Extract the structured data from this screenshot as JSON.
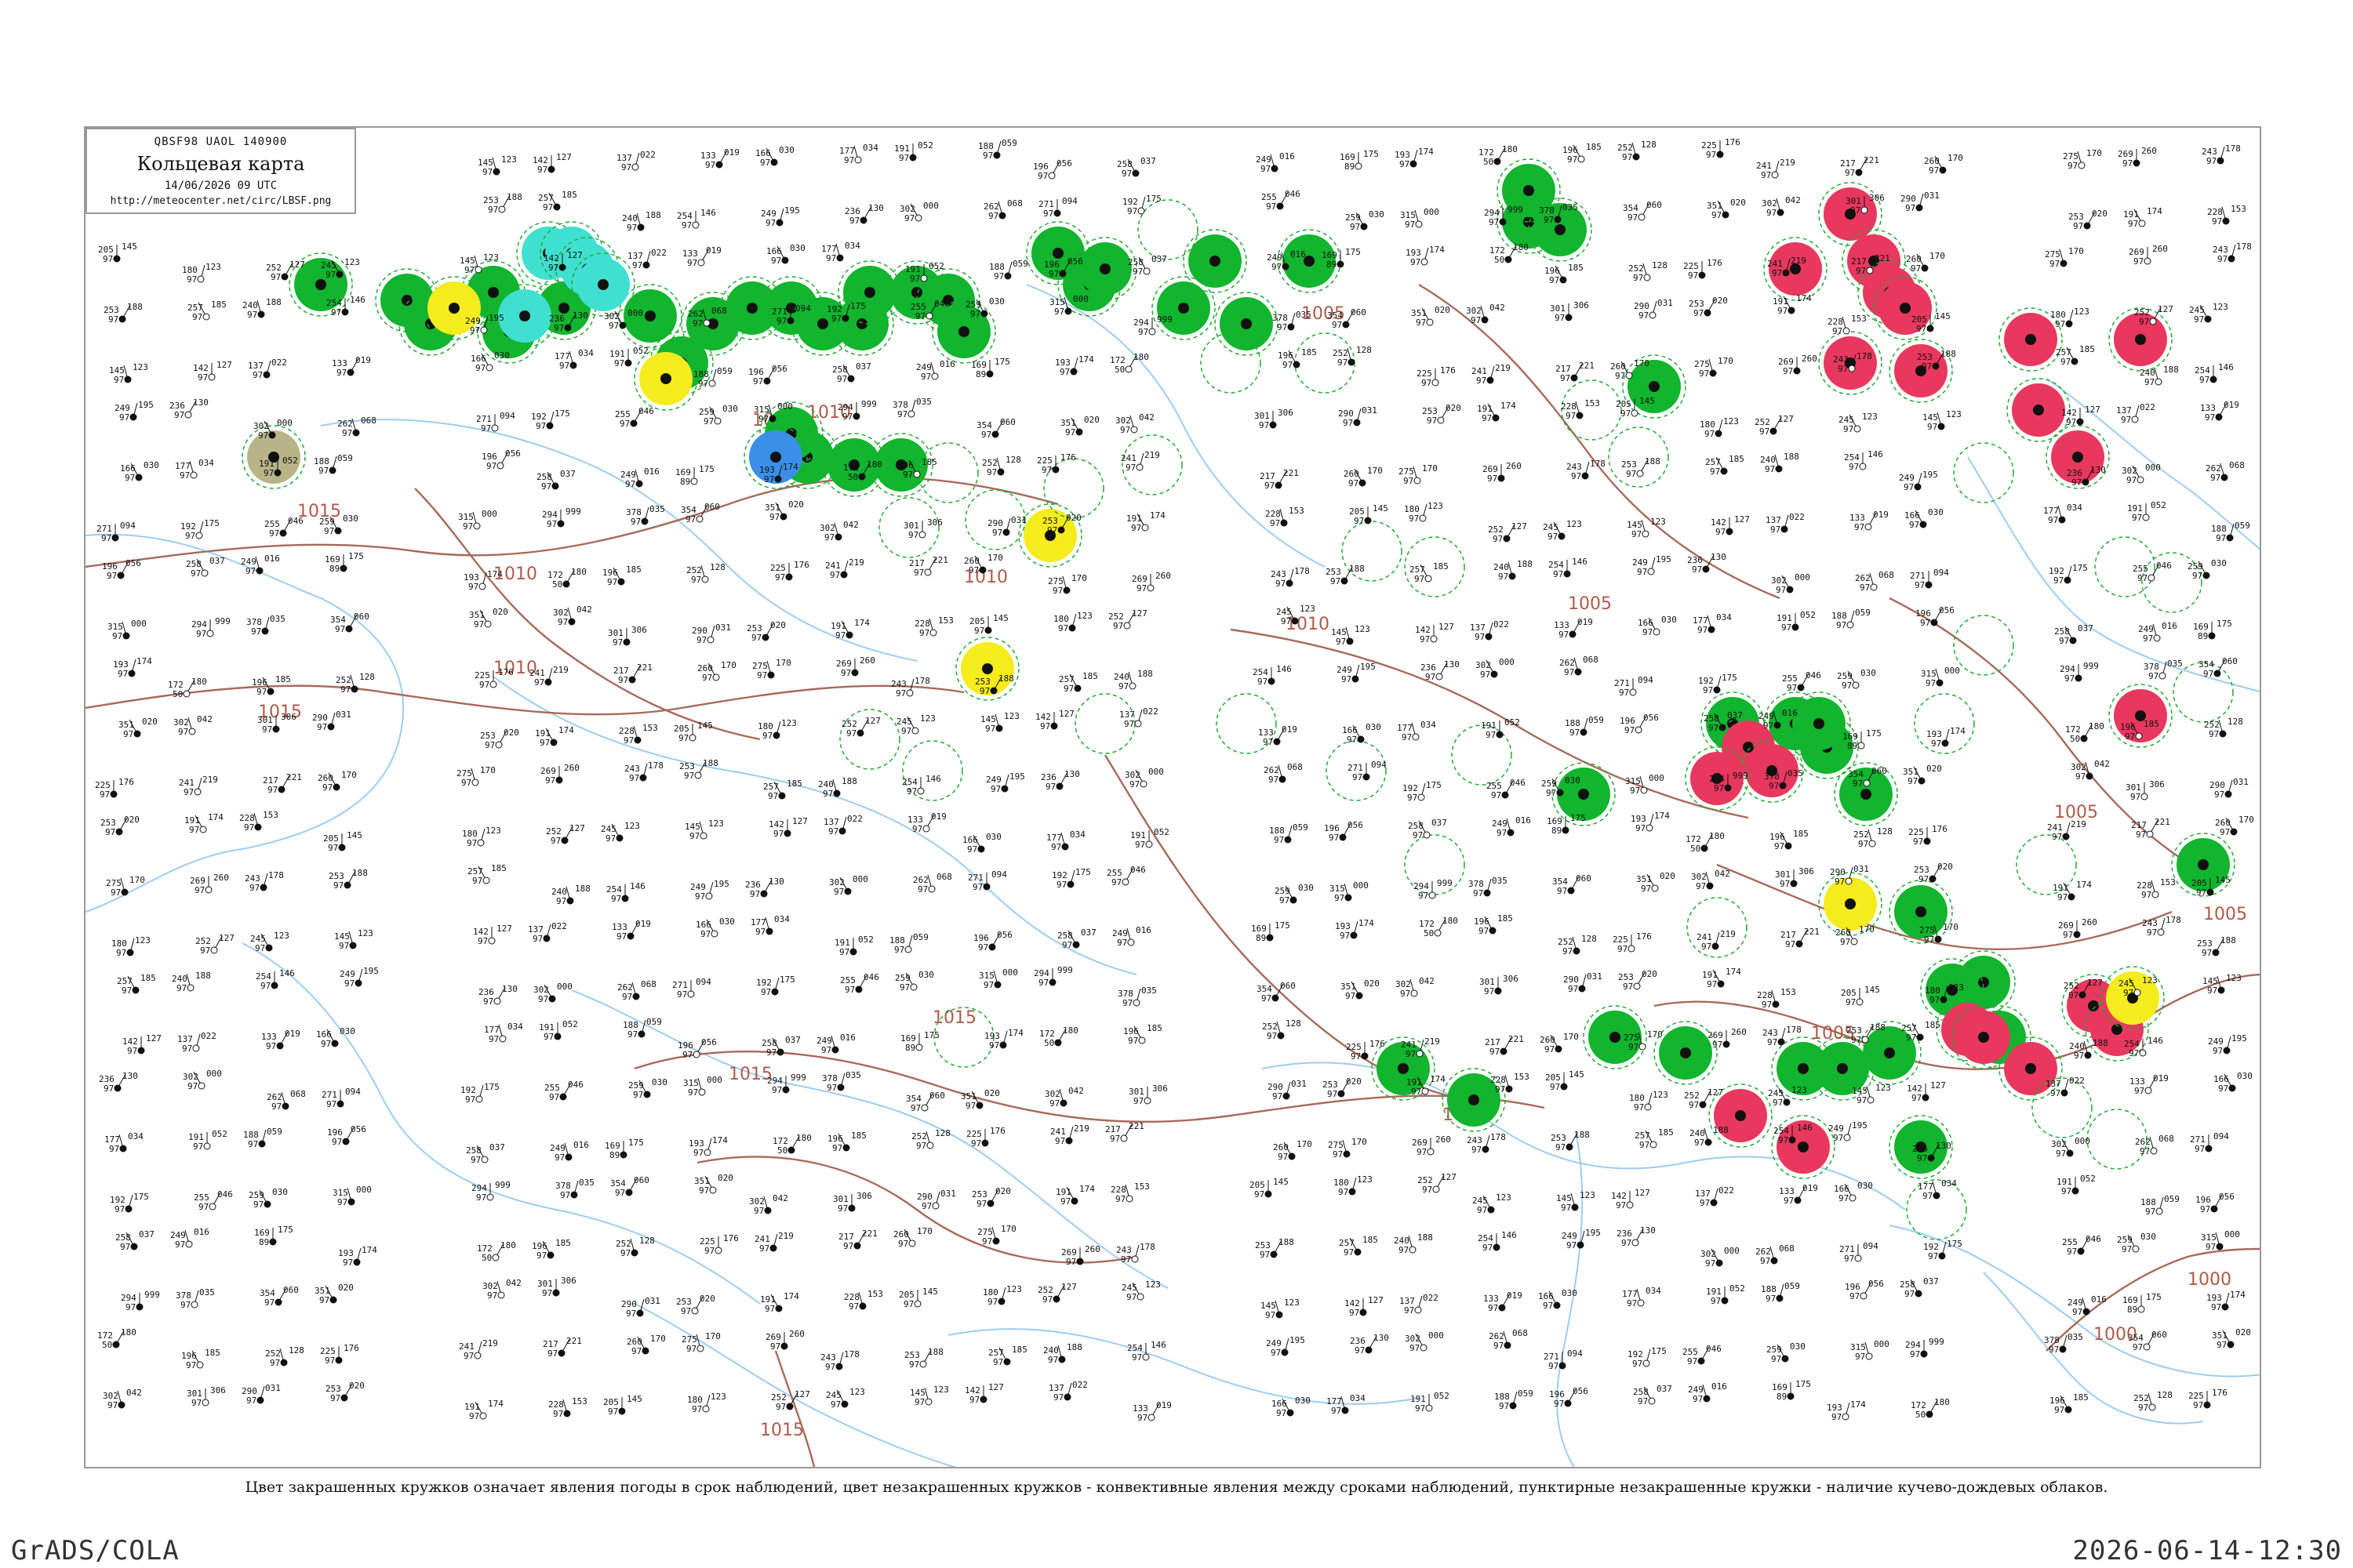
{
  "title_box": {
    "code_line": "QBSF98  UAOL  140900",
    "title": "Кольцевая карта",
    "datetime": "14/06/2026 09 UTC",
    "url": "http://meteocenter.net/circ/LBSF.png"
  },
  "caption": "Цвет закрашенных кружков означает явления погоды в срок наблюдений, цвет незакрашенных кружков - конвективные явления между сроками наблюдений, пунктирные незакрашенные кружки - наличие кучево-дождевых облаков.",
  "footer": {
    "software": "GrADS/COLA",
    "timestamp": "2026-06-14-12:30"
  },
  "isobar_labels": [
    "1010",
    "1015",
    "1010",
    "1015",
    "1010",
    "1005",
    "1010",
    "1015",
    "1015",
    "1005",
    "1005",
    "1010",
    "1005",
    "1005",
    "1000",
    "1000",
    "1015",
    "1010",
    "1015"
  ],
  "colors": {
    "green_fill": "#11b52e",
    "red_fill": "#e8385e",
    "yellow_fill": "#f4ec1c",
    "cyan_fill": "#3fe0d0",
    "blue_fill": "#3a8fe8",
    "olive_fill": "#b8b488",
    "dashed_green": "#22aa33",
    "coastline": "#9ecdf0",
    "isobar": "#a86a5a",
    "station": "#111111"
  },
  "station_samples": [
    {
      "v1": "145",
      "v2": "123",
      "v3": "97"
    },
    {
      "v1": "142",
      "v2": "127",
      "v3": "97"
    },
    {
      "v1": "137",
      "v2": "022",
      "v3": "97"
    },
    {
      "v1": "133",
      "v2": "019",
      "v3": "97"
    },
    {
      "v1": "166",
      "v2": "030",
      "v3": "97"
    },
    {
      "v1": "177",
      "v2": "034",
      "v3": "97"
    },
    {
      "v1": "191",
      "v2": "052",
      "v3": "97"
    },
    {
      "v1": "188",
      "v2": "059",
      "v3": "97"
    },
    {
      "v1": "196",
      "v2": "056",
      "v3": "97"
    },
    {
      "v1": "258",
      "v2": "037",
      "v3": "97"
    },
    {
      "v1": "249",
      "v2": "016",
      "v3": "97"
    },
    {
      "v1": "169",
      "v2": "175",
      "v3": "89"
    },
    {
      "v1": "193",
      "v2": "174",
      "v3": "97"
    },
    {
      "v1": "172",
      "v2": "180",
      "v3": "50"
    },
    {
      "v1": "196",
      "v2": "185",
      "v3": "97"
    },
    {
      "v1": "252",
      "v2": "128",
      "v3": "97"
    },
    {
      "v1": "225",
      "v2": "176",
      "v3": "97"
    },
    {
      "v1": "241",
      "v2": "219",
      "v3": "97"
    },
    {
      "v1": "217",
      "v2": "221",
      "v3": "97"
    },
    {
      "v1": "260",
      "v2": "170",
      "v3": "97"
    },
    {
      "v1": "275",
      "v2": "170",
      "v3": "97"
    },
    {
      "v1": "269",
      "v2": "260",
      "v3": "97"
    },
    {
      "v1": "243",
      "v2": "178",
      "v3": "97"
    },
    {
      "v1": "253",
      "v2": "188",
      "v3": "97"
    },
    {
      "v1": "257",
      "v2": "185",
      "v3": "97"
    },
    {
      "v1": "240",
      "v2": "188",
      "v3": "97"
    },
    {
      "v1": "254",
      "v2": "146",
      "v3": "97"
    },
    {
      "v1": "249",
      "v2": "195",
      "v3": "97"
    },
    {
      "v1": "236",
      "v2": "130",
      "v3": "97"
    },
    {
      "v1": "302",
      "v2": "000",
      "v3": "97"
    },
    {
      "v1": "262",
      "v2": "068",
      "v3": "97"
    },
    {
      "v1": "271",
      "v2": "094",
      "v3": "97"
    },
    {
      "v1": "192",
      "v2": "175",
      "v3": "97"
    },
    {
      "v1": "255",
      "v2": "046",
      "v3": "97"
    },
    {
      "v1": "259",
      "v2": "030",
      "v3": "97"
    },
    {
      "v1": "315",
      "v2": "000",
      "v3": "97"
    },
    {
      "v1": "294",
      "v2": "999",
      "v3": "97"
    },
    {
      "v1": "378",
      "v2": "035",
      "v3": "97"
    },
    {
      "v1": "354",
      "v2": "060",
      "v3": "97"
    },
    {
      "v1": "351",
      "v2": "020",
      "v3": "97"
    },
    {
      "v1": "302",
      "v2": "042",
      "v3": "97"
    },
    {
      "v1": "301",
      "v2": "306",
      "v3": "97"
    },
    {
      "v1": "290",
      "v2": "031",
      "v3": "97"
    },
    {
      "v1": "253",
      "v2": "020",
      "v3": "97"
    },
    {
      "v1": "191",
      "v2": "174",
      "v3": "97"
    },
    {
      "v1": "228",
      "v2": "153",
      "v3": "97"
    },
    {
      "v1": "205",
      "v2": "145",
      "v3": "97"
    },
    {
      "v1": "180",
      "v2": "123",
      "v3": "97"
    },
    {
      "v1": "252",
      "v2": "127",
      "v3": "97"
    },
    {
      "v1": "245",
      "v2": "123",
      "v3": "97"
    }
  ]
}
